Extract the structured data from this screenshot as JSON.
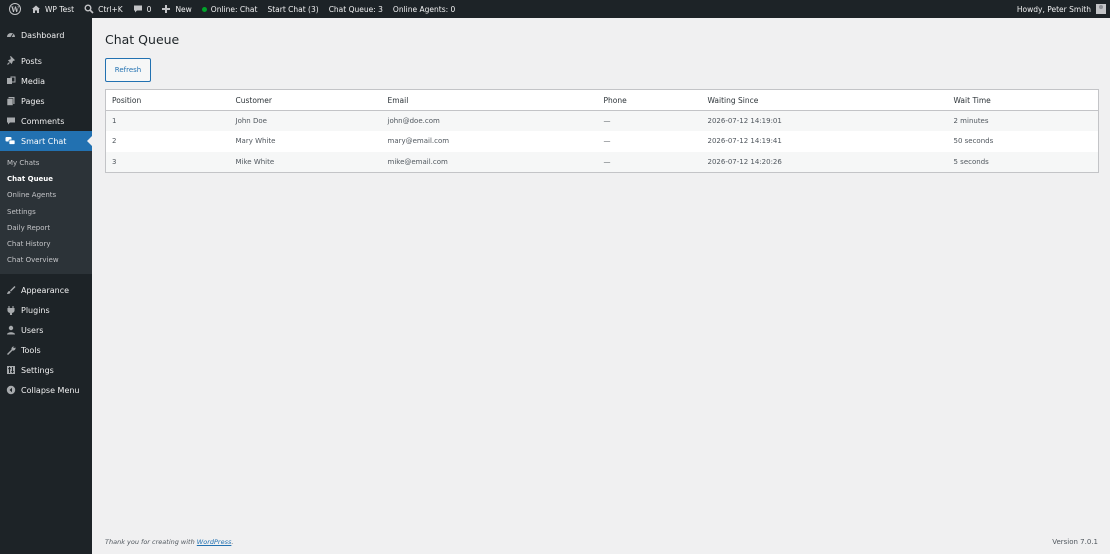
{
  "adminbar": {
    "site_name": "WP Test",
    "search_shortcut": "Ctrl+K",
    "comments_count": "0",
    "new_label": "New",
    "online_status": "Online: Chat",
    "start_chat": "Start Chat (3)",
    "chat_queue": "Chat Queue: 3",
    "online_agents": "Online Agents: 0",
    "howdy": "Howdy, Peter Smith"
  },
  "sidebar": {
    "dashboard": "Dashboard",
    "posts": "Posts",
    "media": "Media",
    "pages": "Pages",
    "comments": "Comments",
    "smart_chat": "Smart Chat",
    "submenu": [
      "My Chats",
      "Chat Queue",
      "Online Agents",
      "Settings",
      "Daily Report",
      "Chat History",
      "Chat Overview"
    ],
    "appearance": "Appearance",
    "plugins": "Plugins",
    "users": "Users",
    "tools": "Tools",
    "settings": "Settings",
    "collapse": "Collapse Menu"
  },
  "main": {
    "title": "Chat Queue",
    "refresh_label": "Refresh",
    "columns": [
      "Position",
      "Customer",
      "Email",
      "Phone",
      "Waiting Since",
      "Wait Time"
    ],
    "rows": [
      [
        "1",
        "John Doe",
        "john@doe.com",
        "—",
        "2026-07-12 14:19:01",
        "2 minutes"
      ],
      [
        "2",
        "Mary White",
        "mary@email.com",
        "—",
        "2026-07-12 14:19:41",
        "50 seconds"
      ],
      [
        "3",
        "Mike White",
        "mike@email.com",
        "—",
        "2026-07-12 14:20:26",
        "5 seconds"
      ]
    ]
  },
  "footer": {
    "thanks_prefix": "Thank you for creating with ",
    "wordpress_link": "WordPress",
    "thanks_suffix": ".",
    "version": "Version 7.0.1"
  },
  "colors": {
    "admin_bg": "#1d2327",
    "accent": "#2271b1",
    "content_bg": "#f0f0f1"
  }
}
